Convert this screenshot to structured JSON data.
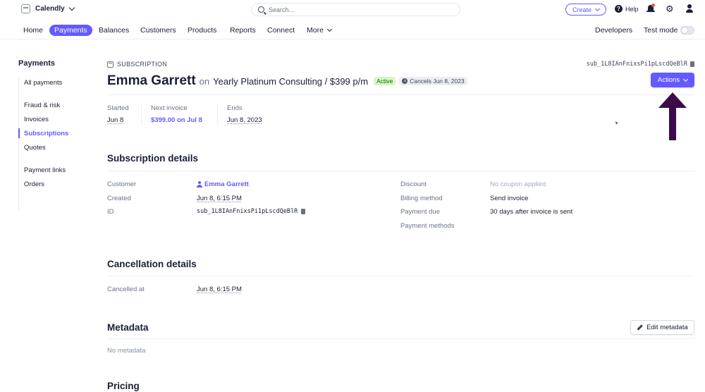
{
  "topbar": {
    "account_name": "Calendly",
    "search_placeholder": "Search...",
    "create_label": "Create",
    "help_label": "Help"
  },
  "nav": {
    "items": [
      "Home",
      "Payments",
      "Balances",
      "Customers",
      "Products",
      "Reports",
      "Connect",
      "More"
    ],
    "active": "Payments",
    "developers_label": "Developers",
    "test_mode_label": "Test mode",
    "test_mode_on": false
  },
  "sidebar": {
    "title": "Payments",
    "items": [
      "All payments",
      "Fraud & risk",
      "Invoices",
      "Subscriptions",
      "Quotes",
      "Payment links",
      "Orders"
    ],
    "active": "Subscriptions"
  },
  "header": {
    "overline": "SUBSCRIPTION",
    "subscription_id": "sub_1L8IAnFnixsPi1pLscdQeBlR",
    "customer_name": "Emma Garrett",
    "on_text": "on",
    "plan": "Yearly Platinum Consulting / $399 p/m",
    "status_badge": "Active",
    "cancel_badge": "Cancels Jun 8, 2023",
    "actions_label": "Actions"
  },
  "summary": {
    "started_label": "Started",
    "started_value": "Jun 8",
    "next_invoice_label": "Next invoice",
    "next_invoice_value": "$399.00 on Jul 8",
    "ends_label": "Ends",
    "ends_value": "Jun 8, 2023"
  },
  "details": {
    "title": "Subscription details",
    "left": [
      {
        "label": "Customer",
        "value": "Emma Garrett"
      },
      {
        "label": "Created",
        "value": "Jun 8, 6:15 PM"
      },
      {
        "label": "ID",
        "value": "sub_1L8IAnFnixsPi1pLscdQeBlR"
      }
    ],
    "right": [
      {
        "label": "Discount",
        "value": "No coupon applied"
      },
      {
        "label": "Billing method",
        "value": "Send invoice"
      },
      {
        "label": "Payment due",
        "value": "30 days after invoice is sent"
      },
      {
        "label": "Payment methods",
        "value": ""
      }
    ]
  },
  "cancellation": {
    "title": "Cancellation details",
    "cancelled_at_label": "Cancelled at",
    "cancelled_at_value": "Jun 8, 6:15 PM"
  },
  "metadata": {
    "title": "Metadata",
    "edit_label": "Edit metadata",
    "empty_text": "No metadata"
  },
  "pricing": {
    "title": "Pricing"
  },
  "colors": {
    "accent": "#635bff",
    "annotation_arrow": "#3b0b4a",
    "active_badge_bg": "#d7f7c2",
    "active_badge_text": "#006908"
  }
}
